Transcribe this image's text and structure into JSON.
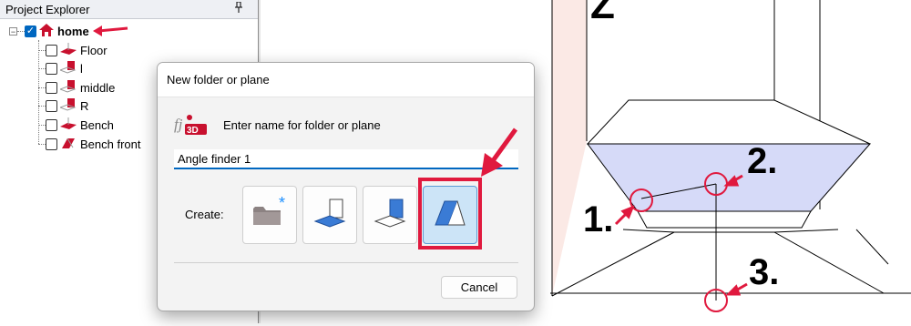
{
  "explorer": {
    "title": "Project Explorer",
    "pin_icon": "pin-icon",
    "root": {
      "label": "home",
      "checked": true,
      "expander": "−"
    },
    "items": [
      {
        "label": "Floor"
      },
      {
        "label": "l"
      },
      {
        "label": "middle"
      },
      {
        "label": "R"
      },
      {
        "label": "Bench"
      },
      {
        "label": "Bench front"
      }
    ]
  },
  "dialog": {
    "title": "New folder or plane",
    "logo_text": "fj3D",
    "prompt": "Enter name for folder or plane",
    "name_value": "Angle finder 1",
    "create_label": "Create:",
    "create_options": [
      "folder-icon",
      "vertical-plane-icon",
      "horizontal-plane-icon",
      "angled-plane-icon"
    ],
    "selected_option": "angled-plane-icon",
    "folder_star": "*",
    "cancel_label": "Cancel"
  },
  "annotations": {
    "point1": "1.",
    "point2": "2.",
    "point3": "3.",
    "view_glyph": "Z"
  },
  "colors": {
    "accent": "#0067c0",
    "marker_red": "#e0193e",
    "plane_fill": "#d6daf8",
    "wall_tint": "#fbe9e5",
    "icon_blue": "#4a86c8"
  }
}
